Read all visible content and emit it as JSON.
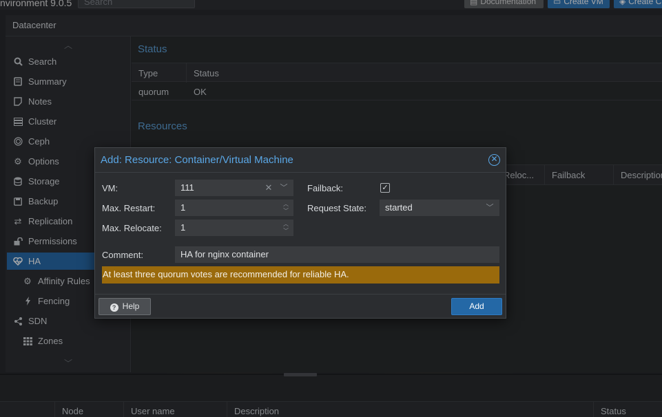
{
  "topbar": {
    "app_title": "nvironment 9.0.5",
    "search_placeholder": "Search",
    "documentation_label": "Documentation",
    "create_vm_label": "Create VM",
    "create_ct_label": "Create C"
  },
  "datacenter": {
    "title": "Datacenter"
  },
  "sidebar": {
    "items": [
      {
        "label": "Search",
        "icon": "search-icon"
      },
      {
        "label": "Summary",
        "icon": "book-icon"
      },
      {
        "label": "Notes",
        "icon": "note-icon"
      },
      {
        "label": "Cluster",
        "icon": "server-icon"
      },
      {
        "label": "Ceph",
        "icon": "ceph-icon"
      },
      {
        "label": "Options",
        "icon": "gear-icon"
      },
      {
        "label": "Storage",
        "icon": "database-icon"
      },
      {
        "label": "Backup",
        "icon": "save-icon"
      },
      {
        "label": "Replication",
        "icon": "retweet-icon"
      },
      {
        "label": "Permissions",
        "icon": "unlock-icon"
      },
      {
        "label": "HA",
        "icon": "heartbeat-icon",
        "active": true
      },
      {
        "label": "Affinity Rules",
        "icon": "gears-icon"
      },
      {
        "label": "Fencing",
        "icon": "bolt-icon"
      },
      {
        "label": "SDN",
        "icon": "sdn-icon"
      },
      {
        "label": "Zones",
        "icon": "grid-icon"
      }
    ]
  },
  "status_panel": {
    "title": "Status",
    "columns": [
      "Type",
      "Status"
    ],
    "rows": [
      {
        "type": "quorum",
        "status": "OK"
      }
    ]
  },
  "resources_panel": {
    "title": "Resources",
    "columns": [
      "Reloc...",
      "Failback",
      "Description"
    ]
  },
  "bottom_panel": {
    "columns": [
      "Node",
      "User name",
      "Description",
      "Status"
    ]
  },
  "dialog": {
    "title": "Add: Resource: Container/Virtual Machine",
    "vm_label": "VM:",
    "vm_value": "111",
    "max_restart_label": "Max. Restart:",
    "max_restart_value": "1",
    "max_relocate_label": "Max. Relocate:",
    "max_relocate_value": "1",
    "failback_label": "Failback:",
    "failback_checked": true,
    "request_state_label": "Request State:",
    "request_state_value": "started",
    "comment_label": "Comment:",
    "comment_value": "HA for nginx container",
    "warning": "At least three quorum votes are recommended for reliable HA.",
    "help_label": "Help",
    "add_label": "Add"
  },
  "colors": {
    "accent": "#2468a6",
    "title_blue": "#5aa7e6",
    "warning_bg": "#9a6a0c"
  }
}
